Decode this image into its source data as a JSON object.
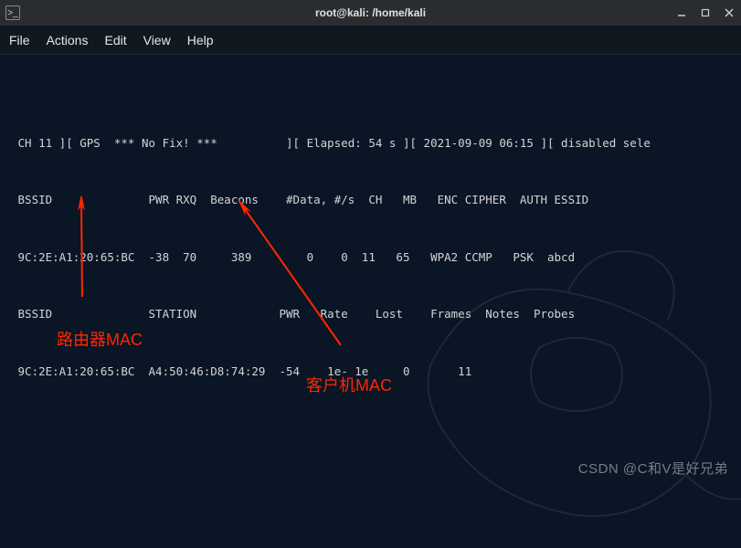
{
  "titlebar": {
    "title": "root@kali: /home/kali"
  },
  "menu": {
    "file": "File",
    "actions": "Actions",
    "edit": "Edit",
    "view": "View",
    "help": "Help"
  },
  "terminal": {
    "status_line": " CH 11 ][ GPS  *** No Fix! ***          ][ Elapsed: 54 s ][ 2021-09-09 06:15 ][ disabled sele",
    "ap_header": " BSSID              PWR RXQ  Beacons    #Data, #/s  CH   MB   ENC CIPHER  AUTH ESSID",
    "ap_row": " 9C:2E:A1:20:65:BC  -38  70     389        0    0  11   65   WPA2 CCMP   PSK  abcd",
    "client_header": " BSSID              STATION            PWR   Rate    Lost    Frames  Notes  Probes",
    "client_row": " 9C:2E:A1:20:65:BC  A4:50:46:D8:74:29  -54    1e- 1e     0       11"
  },
  "annotations": {
    "router_mac": "路由器MAC",
    "client_mac": "客户机MAC"
  },
  "watermark": "CSDN @C和V是好兄弟",
  "chart_data": {
    "type": "table",
    "status": {
      "channel": 11,
      "gps": "No Fix!",
      "elapsed_seconds": 54,
      "timestamp": "2021-09-09 06:15",
      "note": "disabled sele"
    },
    "access_points": {
      "columns": [
        "BSSID",
        "PWR",
        "RXQ",
        "Beacons",
        "#Data",
        "#/s",
        "CH",
        "MB",
        "ENC",
        "CIPHER",
        "AUTH",
        "ESSID"
      ],
      "rows": [
        [
          "9C:2E:A1:20:65:BC",
          -38,
          70,
          389,
          0,
          0,
          11,
          65,
          "WPA2",
          "CCMP",
          "PSK",
          "abcd"
        ]
      ]
    },
    "clients": {
      "columns": [
        "BSSID",
        "STATION",
        "PWR",
        "Rate",
        "Lost",
        "Frames",
        "Notes",
        "Probes"
      ],
      "rows": [
        [
          "9C:2E:A1:20:65:BC",
          "A4:50:46:D8:74:29",
          -54,
          "1e- 1e",
          0,
          11,
          "",
          ""
        ]
      ]
    }
  }
}
